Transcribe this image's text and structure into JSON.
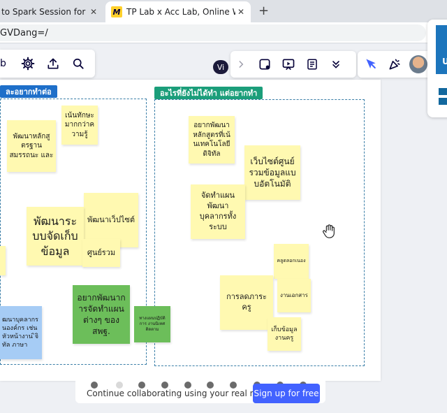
{
  "browser": {
    "tabs": [
      {
        "title": "to Spark Session for OBEC",
        "close": "✕"
      },
      {
        "title": "TP Lab x Acc Lab, Online Whiteboa",
        "favicon": "M",
        "close": "✕"
      }
    ],
    "new_tab": "+",
    "url": "GVDang=/"
  },
  "toolbar": {
    "left_partial_text": "b",
    "icons": [
      "gear-icon",
      "upload-icon",
      "search-icon"
    ],
    "collaborator_initials": "Vi",
    "right_icons": [
      "chevron-right-icon",
      "sticker-icon",
      "presentation-icon",
      "notes-icon",
      "chevron-double-down-icon",
      "cursor-icon",
      "celebrate-icon"
    ]
  },
  "board": {
    "sections": [
      {
        "label": "ละอยากทำต่อ",
        "color": "#1e6fc9"
      },
      {
        "label": "อะไรที่ยังไม่ได้ทำ แต่อยากทำ",
        "color": "#1b9e7a"
      }
    ],
    "notes": [
      {
        "id": "n1",
        "text": "เน้นทักษะ มากกว่าค วามรู้",
        "color": "yellow"
      },
      {
        "id": "n2",
        "text": "พัฒนาหลักสู ตรฐานสมรรถนะ และ",
        "color": "yellow"
      },
      {
        "id": "n3",
        "text": "พัฒนาเว็ปไซต์",
        "color": "yellow"
      },
      {
        "id": "n4",
        "text": "พัฒนาระ บบจัดเก็บ ข้อมูล",
        "color": "yellow"
      },
      {
        "id": "n5",
        "text": "ศูนย์รวม",
        "color": "yellow"
      },
      {
        "id": "n6",
        "text": "อยากพัฒนาก ารจัดทำแผน ต่างๆ ของ สพฐ.",
        "color": "green"
      },
      {
        "id": "n7",
        "text": "ทางแผนปฏิบัติการ งานนิเทศติดตาม",
        "color": "green"
      },
      {
        "id": "n8",
        "text": "ฒนาบุคลากร นองค์กร เช่น หัวหน้างาน ิจิทัล ภาษา",
        "color": "blue"
      },
      {
        "id": "n9",
        "text": "อยากพัฒนา หลักสูตรที่เน้ นเทคโนโลยี ดิจิทัล",
        "color": "yellow"
      },
      {
        "id": "n10",
        "text": "เว็บไซต์ศูนย์ รวมข้อมูลแบ บอัตโนมัติ",
        "color": "yellow"
      },
      {
        "id": "n11",
        "text": "จัดทำแผนพัฒนา บุคลากรทั้งระบบ",
        "color": "yellow"
      },
      {
        "id": "n12",
        "text": "คลูดลอกเนอง",
        "color": "yellow"
      },
      {
        "id": "n13",
        "text": "การลดภาระครู",
        "color": "yellow"
      },
      {
        "id": "n14",
        "text": "งานเอกสาร",
        "color": "yellow"
      },
      {
        "id": "n15",
        "text": "เก็บข้อมูล งานครู",
        "color": "yellow"
      }
    ]
  },
  "banner": {
    "text": "Continue collaborating using your real name.",
    "button": "Sign up for free"
  },
  "colors": {
    "accent": "#4262ff",
    "sticky_yellow": "#fff9b1",
    "sticky_green": "#6cbe5a",
    "sticky_blue": "#a6ccf5"
  }
}
